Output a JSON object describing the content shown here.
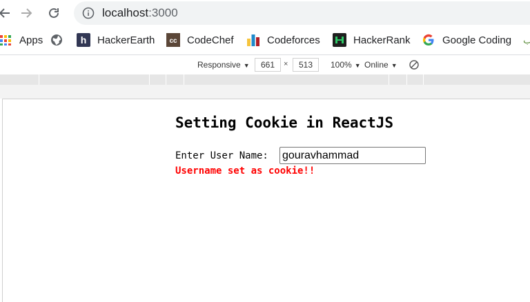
{
  "browser": {
    "url_host": "localhost",
    "url_port": ":3000"
  },
  "bookmarks": [
    {
      "label": "Apps",
      "icon": "apps-grid-icon"
    },
    {
      "label": "",
      "icon": "globe-icon"
    },
    {
      "label": "HackerEarth",
      "icon": "hackerearth-icon"
    },
    {
      "label": "CodeChef",
      "icon": "codechef-icon"
    },
    {
      "label": "Codeforces",
      "icon": "codeforces-icon"
    },
    {
      "label": "HackerRank",
      "icon": "hackerrank-icon"
    },
    {
      "label": "Google Coding",
      "icon": "google-icon"
    }
  ],
  "devtools": {
    "device": "Responsive",
    "width": "661",
    "times": "×",
    "height": "513",
    "zoom": "100%",
    "throttle": "Online"
  },
  "page": {
    "title": "Setting Cookie in ReactJS",
    "field_label": "Enter User Name:",
    "username_value": "gouravhammad",
    "status_message": "Username set as cookie!!"
  },
  "colors": {
    "status": "#ff0000",
    "omnibox_bg": "#f1f3f4"
  }
}
